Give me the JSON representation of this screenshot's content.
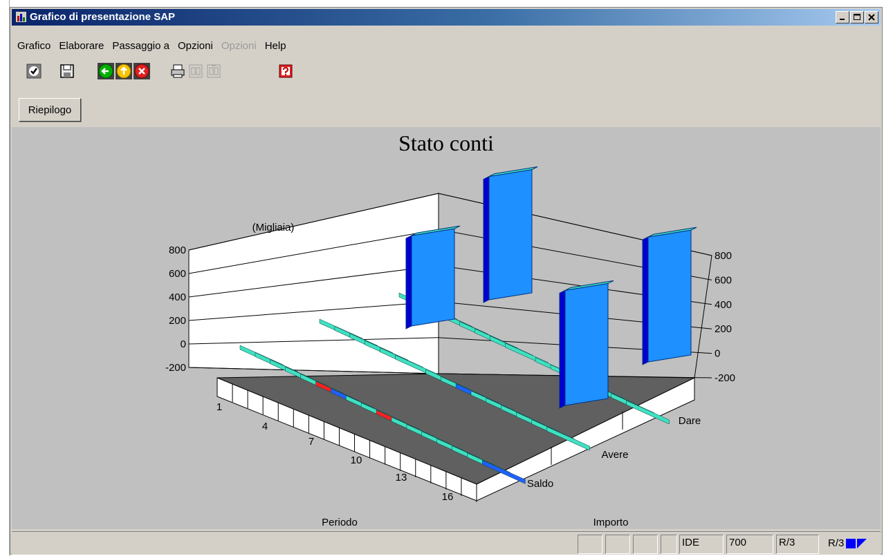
{
  "window": {
    "title": "Grafico di presentazione SAP",
    "buttons": [
      "minimize-icon",
      "maximize-icon",
      "close-icon"
    ]
  },
  "menu": [
    {
      "label": "Grafico",
      "enabled": true
    },
    {
      "label": "Elaborare",
      "enabled": true
    },
    {
      "label": "Passaggio a",
      "enabled": true
    },
    {
      "label": "Opzioni",
      "enabled": true
    },
    {
      "label": "Opzioni",
      "enabled": false
    },
    {
      "label": "Help",
      "enabled": true
    }
  ],
  "toolbar": [
    {
      "name": "check-icon",
      "color": "#808080"
    },
    {
      "name": "save-icon",
      "color": "#808080"
    },
    {
      "name": "back-icon",
      "color": "#00a000"
    },
    {
      "name": "up-icon",
      "color": "#f0c000"
    },
    {
      "name": "cancel-icon",
      "color": "#d02020"
    },
    {
      "name": "print-icon",
      "color": "#808080"
    },
    {
      "name": "find-icon",
      "color": "#a0a0a0"
    },
    {
      "name": "find-next-icon",
      "color": "#a0a0a0"
    },
    {
      "name": "help-icon",
      "color": "#d02020"
    }
  ],
  "app_toolbar": {
    "summary_label": "Riepilogo"
  },
  "chart_data": {
    "type": "bar",
    "title": "Stato conti",
    "unit_label": "(Migliaia)",
    "z_ticks": [
      "800",
      "600",
      "400",
      "200",
      "0",
      "-200"
    ],
    "ylim": [
      -200,
      800
    ],
    "x_axis_label": "Periodo",
    "x_ticks": [
      "1",
      "4",
      "7",
      "10",
      "13",
      "16"
    ],
    "y_axis_label": "Importo",
    "y_ticks": [
      "Saldo",
      "Avere",
      "Dare"
    ],
    "periods": 17,
    "series": [
      {
        "name": "Saldo",
        "values": [
          0,
          0,
          0,
          0,
          0,
          -30,
          -50,
          0,
          0,
          -30,
          0,
          0,
          0,
          0,
          0,
          0,
          -50
        ]
      },
      {
        "name": "Avere",
        "values": [
          0,
          0,
          0,
          0,
          0,
          0,
          550,
          60,
          0,
          -30,
          0,
          0,
          0,
          0,
          0,
          0,
          750
        ]
      },
      {
        "name": "Dare",
        "values": [
          0,
          0,
          0,
          0,
          0,
          0,
          0,
          0,
          700,
          80,
          0,
          -30,
          0,
          0,
          0,
          0,
          760
        ]
      }
    ],
    "colors": {
      "tall": "#1e90ff",
      "flat": "#40e0c0",
      "negative": "#ff2020",
      "floor": "#606060"
    }
  },
  "status": {
    "fields": [
      "",
      "",
      "",
      "",
      "IDE",
      "700",
      "R/3"
    ],
    "system": "R/3"
  }
}
